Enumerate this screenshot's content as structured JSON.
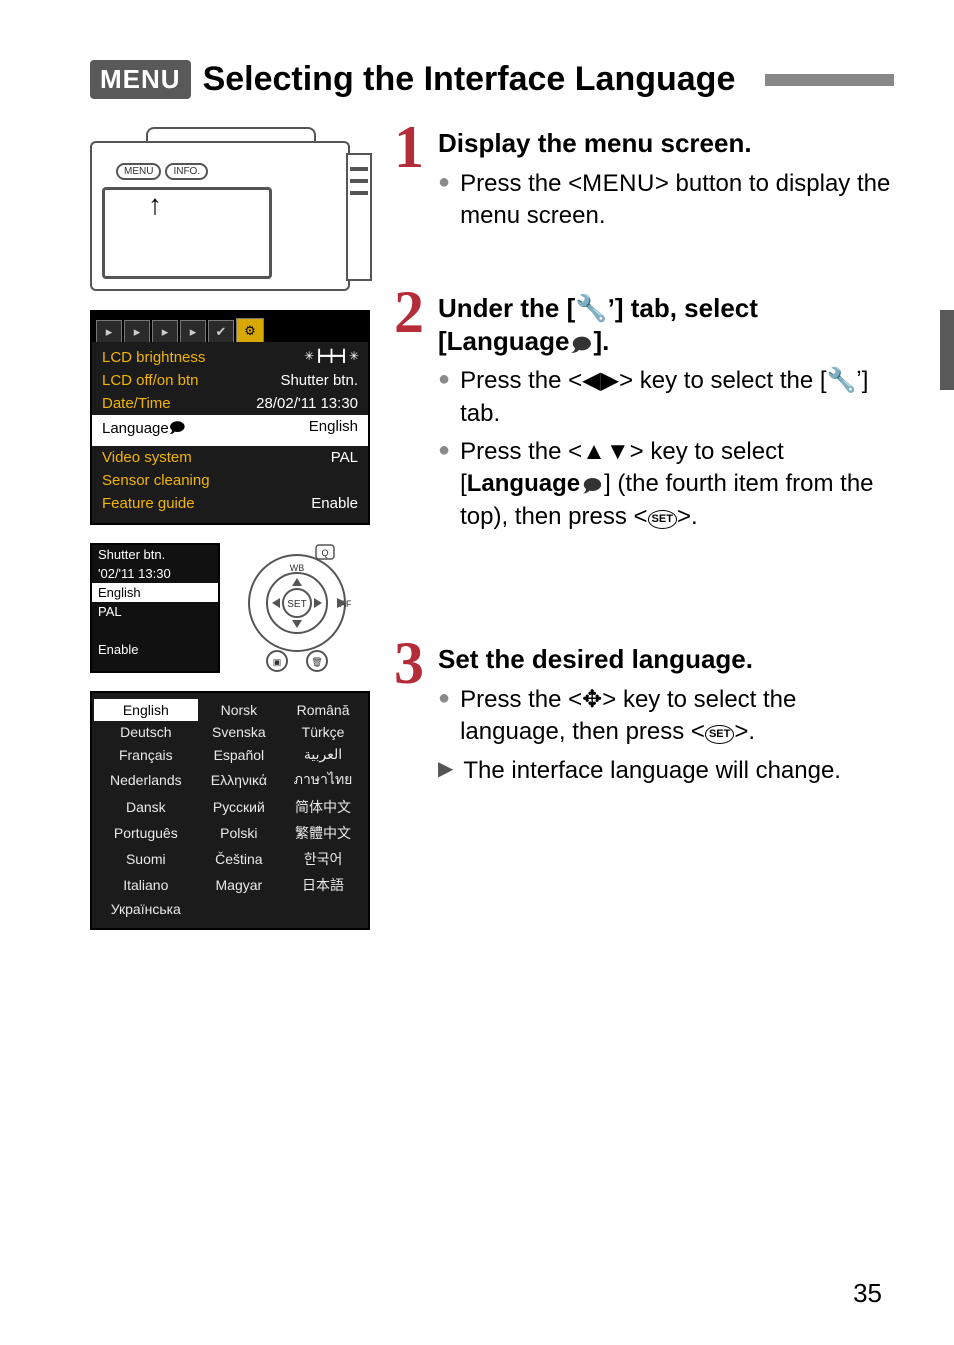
{
  "title": {
    "menu_badge": "MENU",
    "text": "Selecting the Interface Language"
  },
  "page_number": "35",
  "camera_buttons": {
    "menu": "MENU",
    "info": "INFO."
  },
  "menu_screen": {
    "tabs": [
      "▸",
      "▸",
      "▸",
      "▸",
      "✔",
      "⚙"
    ],
    "rows": [
      {
        "k": "LCD brightness",
        "v": "✳ ┣━╋━┫ ✳"
      },
      {
        "k": "LCD off/on btn",
        "v": "Shutter btn."
      },
      {
        "k": "Date/Time",
        "v": "28/02/'11 13:30"
      },
      {
        "k": "Language🗩",
        "v": "English",
        "hl": true
      },
      {
        "k": "Video system",
        "v": "PAL"
      },
      {
        "k": "Sensor cleaning",
        "v": ""
      },
      {
        "k": "Feature guide",
        "v": "Enable"
      }
    ]
  },
  "snippet_rows": [
    "Shutter btn.",
    "'02/'11 13:30",
    "English",
    "PAL",
    "",
    "Enable"
  ],
  "snippet_hl_index": 2,
  "dial_labels": {
    "top": "Q",
    "wb": "WB",
    "set": "SET",
    "af": "AF",
    "play": "▣",
    "trash": "🗑"
  },
  "languages": {
    "col1": [
      "English",
      "Deutsch",
      "Français",
      "Nederlands",
      "Dansk",
      "Português",
      "Suomi",
      "Italiano",
      "Українська"
    ],
    "col2": [
      "Norsk",
      "Svenska",
      "Español",
      "Ελληνικά",
      "Русский",
      "Polski",
      "Čeština",
      "Magyar",
      ""
    ],
    "col3": [
      "Română",
      "Türkçe",
      "العربية",
      "ภาษาไทย",
      "简体中文",
      "繁體中文",
      "한국어",
      "日本語",
      ""
    ]
  },
  "steps": {
    "s1": {
      "num": "1",
      "head": "Display the menu screen.",
      "b1a": "Press the <",
      "b1b": "MENU",
      "b1c": "> button to display the menu screen."
    },
    "s2": {
      "num": "2",
      "head_a": "Under the [",
      "head_wrench": "🔧",
      "head_sup": "ʼ",
      "head_b": "] tab, select [Language",
      "head_lang_icon": "🗩",
      "head_c": "].",
      "b1a": "Press the <",
      "b1arrows": "◀▶",
      "b1b": "> key to select the [",
      "b1wr": "🔧",
      "b1sup": "ʼ",
      "b1c": "] tab.",
      "b2a": "Press the <",
      "b2arrows": "▲▼",
      "b2b": "> key to select [",
      "b2lang": "Language",
      "b2icon": "🗩",
      "b2c": "] (the fourth item from the top), then press <",
      "b2set": "SET",
      "b2d": ">."
    },
    "s3": {
      "num": "3",
      "head": "Set the desired language.",
      "b1a": "Press the <",
      "b1cross": "✥",
      "b1b": "> key to select the language, then press <",
      "b1set": "SET",
      "b1c": ">.",
      "b2": "The interface language will change."
    }
  }
}
